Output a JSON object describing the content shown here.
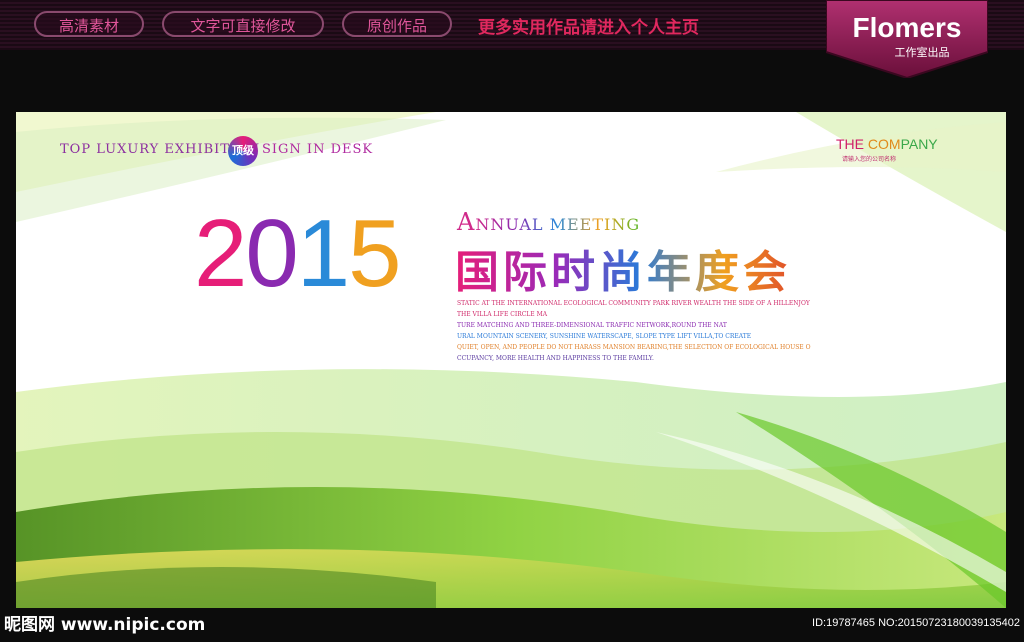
{
  "header": {
    "pills": [
      "高清素材",
      "文字可直接修改",
      "原创作品"
    ],
    "promo": "更多实用作品请进入个人主页",
    "brand": "Flomers",
    "brand_sub": "工作室出品"
  },
  "poster": {
    "top_line_1": "TOP LUXURY EXHIBITION",
    "top_badge": "顶级",
    "top_line_2": "SIGN IN DESK",
    "company": {
      "p1": "THE",
      "p2": "COM",
      "p3": "PANY"
    },
    "company_sub": "请输入您的公司名称",
    "year_digits": [
      "2",
      "0",
      "1",
      "5"
    ],
    "annual_a": "A",
    "annual_rest": "NNUAL MEETING",
    "title_cn": "国际时尚年度会",
    "body_lines": [
      "STATIC AT THE INTERNATIONAL ECOLOGICAL COMMUNITY PARK RIVER WEALTH THE SIDE OF A HILLENJOY",
      "THE VILLA LIFE CIRCLE MA",
      "TURE MATCHING AND THREE-DIMENSIONAL TRAFFIC NETWORK,ROUND THE NAT",
      "URAL MOUNTAIN SCENERY, SUNSHINE WATERSCAPE, SLOPE TYPE LIFT VILLA,TO CREATE",
      "QUIET, OPEN, AND PEOPLE DO NOT HARASS MANSION BEARING,THE SELECTION OF ECOLOGICAL HOUSE O",
      "CCUPANCY, MORE HEALTH AND HAPPINESS TO THE FAMILY."
    ],
    "colors": {
      "magenta": "#e61e78",
      "purple": "#8a2ab0",
      "blue": "#2a6fd8",
      "orange": "#f0a020",
      "green": "#5ab82a"
    }
  },
  "footer": {
    "watermark": "昵图网 www.nipic.com",
    "image_id": "ID:19787465 NO:20150723180039135402"
  }
}
